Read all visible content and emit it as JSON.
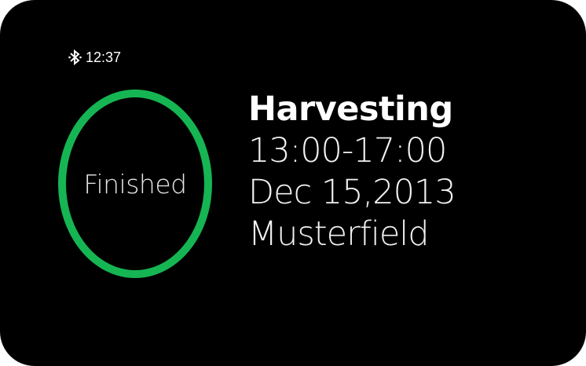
{
  "status_bar": {
    "bluetooth_icon": "bluetooth-icon",
    "time": "12:37"
  },
  "status_ring": {
    "label": "Finished",
    "color": "#16b553"
  },
  "event": {
    "title": "Harvesting",
    "time_range": "13:00-17:00",
    "date": "Dec 15,2013",
    "location": "Musterfield"
  }
}
